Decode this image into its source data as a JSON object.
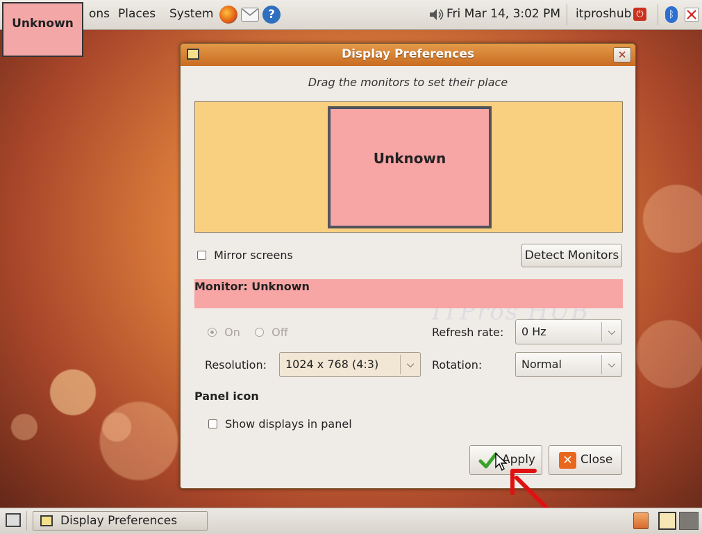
{
  "top_panel": {
    "menu": [
      "ons",
      "Places",
      "System"
    ],
    "clock": "Fri Mar 14,  3:02 PM",
    "user": "itproshub"
  },
  "badge": {
    "label": "Unknown"
  },
  "dialog": {
    "title": "Display Preferences",
    "hint": "Drag the monitors to set their place",
    "monitor_box_label": "Unknown",
    "mirror_label": "Mirror screens",
    "mirror_checked": false,
    "detect_label": "Detect Monitors",
    "monitor_heading": "Monitor: Unknown",
    "on_label": "On",
    "off_label": "Off",
    "refresh_label": "Refresh rate:",
    "refresh_value": "0 Hz",
    "resolution_label": "Resolution:",
    "resolution_value": "1024 x 768 (4:3)",
    "rotation_label": "Rotation:",
    "rotation_value": "Normal",
    "panel_icon_heading": "Panel icon",
    "show_displays_label": "Show displays in panel",
    "show_displays_checked": false,
    "apply_label": "Apply",
    "close_label": "Close"
  },
  "watermark": "ITPros HUB",
  "bottom_panel": {
    "task_label": "Display Preferences"
  },
  "colors": {
    "monitor_pink": "#f7a5a5",
    "canvas_tan": "#f9cf80",
    "title_orange": "#d97e34",
    "arrow_red": "#e01010"
  }
}
